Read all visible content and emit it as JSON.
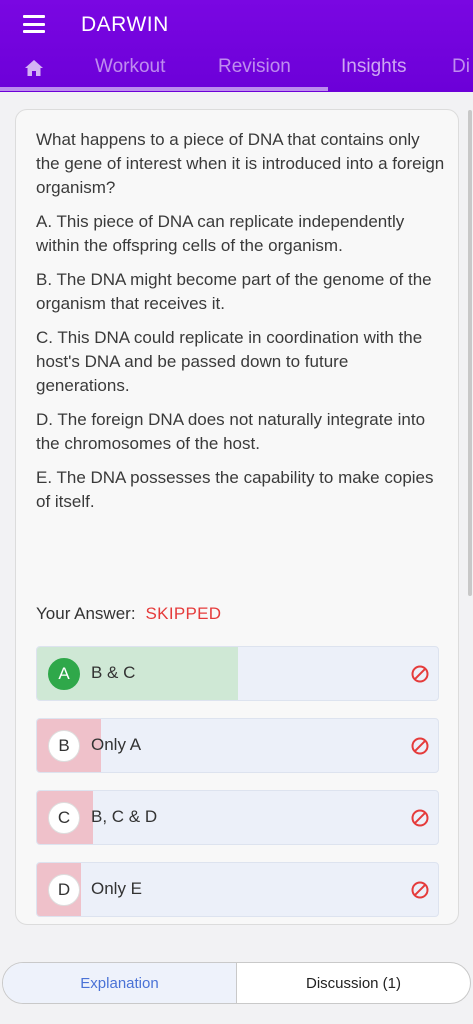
{
  "app": {
    "title": "DARWIN"
  },
  "tabs": [
    {
      "label": "Workout"
    },
    {
      "label": "Revision"
    },
    {
      "label": "Insights"
    },
    {
      "label": "Di"
    }
  ],
  "question": {
    "text": "What happens to a piece of DNA that contains only the gene of interest when it is introduced into a foreign organism?",
    "statements": [
      "A. This piece of DNA can replicate independently within the offspring cells of the organism.",
      "B. The DNA might become part of the genome of the organism that receives it.",
      "C. This DNA could replicate in coordination with the host's DNA and be passed down to future generations.",
      "D. The foreign DNA does not naturally integrate into the chromosomes of the host.",
      "E. The DNA possesses the capability to make copies of itself."
    ]
  },
  "answer": {
    "label": "Your Answer:",
    "status": "SKIPPED"
  },
  "options": [
    {
      "letter": "A",
      "text": "B & C",
      "correct": true,
      "percent": 50
    },
    {
      "letter": "B",
      "text": "Only A",
      "correct": false,
      "percent": 16
    },
    {
      "letter": "C",
      "text": "B, C & D",
      "correct": false,
      "percent": 14
    },
    {
      "letter": "D",
      "text": "Only E",
      "correct": false,
      "percent": 11
    }
  ],
  "bottom": {
    "explanation_label": "Explanation",
    "discussion_label": "Discussion (1)"
  },
  "colors": {
    "appbar": "#6c00d8",
    "correct": "#2fa84a",
    "wrong_icon": "#e53b3b",
    "link": "#4a72d6"
  },
  "icons": {
    "menu": "menu-icon",
    "home": "home-icon",
    "not_selected": "no-entry-icon"
  }
}
